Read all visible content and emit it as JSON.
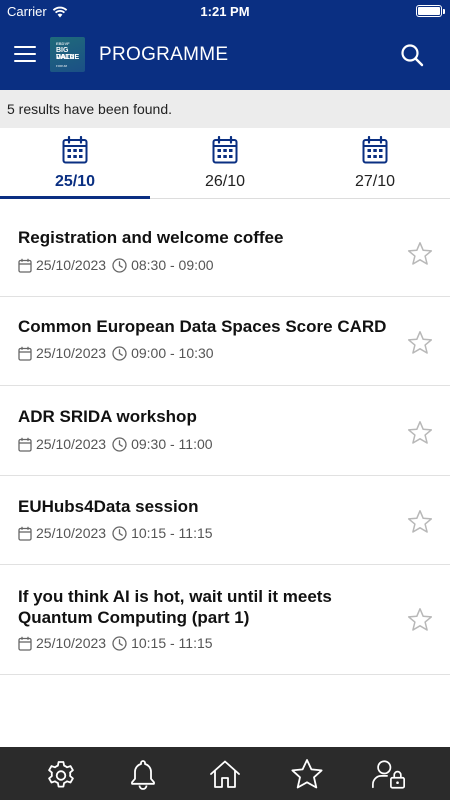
{
  "status_bar": {
    "carrier": "Carrier",
    "time": "1:21 PM"
  },
  "header": {
    "title": "PROGRAMME",
    "logo": {
      "line1": "EBDVF",
      "line2": "BIG DATA",
      "line3": "VALUE",
      "line4": "FORUM"
    }
  },
  "results_text": "5 results have been found.",
  "date_tabs": [
    {
      "label": "25/10",
      "active": true
    },
    {
      "label": "26/10",
      "active": false
    },
    {
      "label": "27/10",
      "active": false
    }
  ],
  "sessions": [
    {
      "title": "Registration and welcome coffee",
      "date": "25/10/2023",
      "time": "08:30 - 09:00"
    },
    {
      "title": "Common European Data Spaces Score CARD",
      "date": "25/10/2023",
      "time": "09:00 - 10:30"
    },
    {
      "title": "ADR SRIDA workshop",
      "date": "25/10/2023",
      "time": "09:30 - 11:00"
    },
    {
      "title": "EUHubs4Data session",
      "date": "25/10/2023",
      "time": "10:15 - 11:15"
    },
    {
      "title": "If you think AI is hot, wait until it meets Quantum Computing (part 1)",
      "date": "25/10/2023",
      "time": "10:15 - 11:15"
    }
  ],
  "bottom_nav": [
    {
      "icon": "gear-icon"
    },
    {
      "icon": "bell-icon"
    },
    {
      "icon": "home-icon"
    },
    {
      "icon": "star-icon"
    },
    {
      "icon": "user-lock-icon"
    }
  ],
  "colors": {
    "primary": "#0a2f82",
    "results_bg": "#ececec",
    "tab_bar_bg": "#2b2b2b"
  }
}
